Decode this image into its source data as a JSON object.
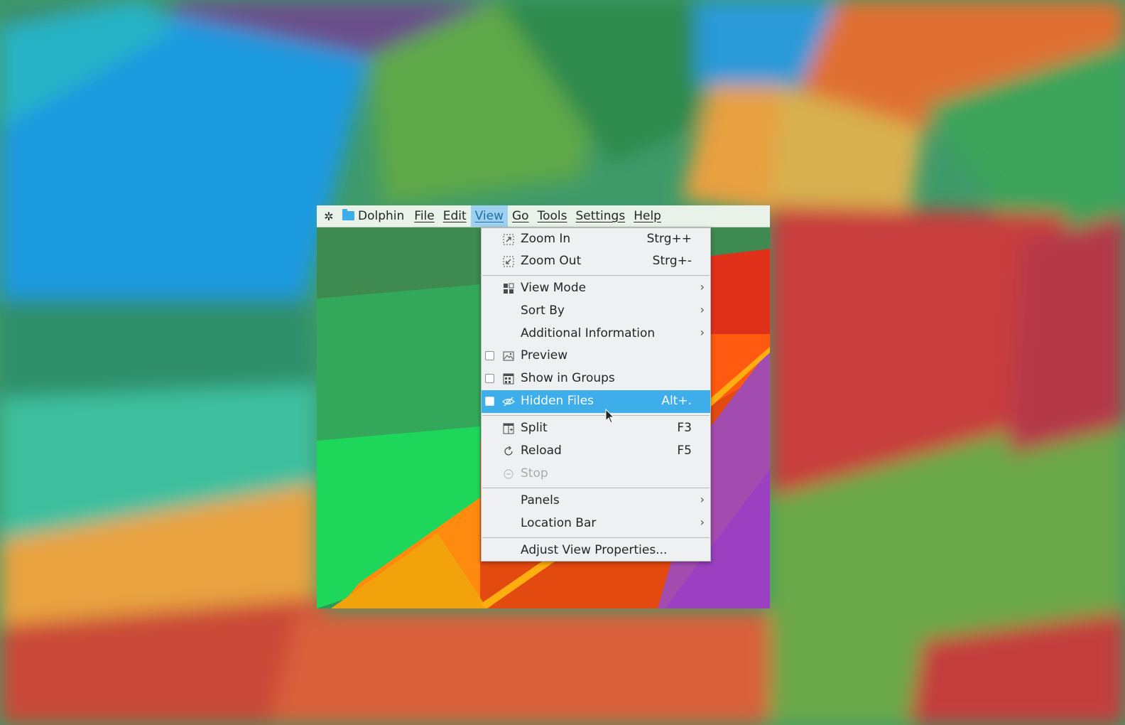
{
  "menubar": {
    "kde_logo": "kde-icon",
    "app_name": "Dolphin",
    "items": [
      "File",
      "Edit",
      "View",
      "Go",
      "Tools",
      "Settings",
      "Help"
    ],
    "active": "View"
  },
  "view_menu": {
    "zoom_in": {
      "label": "Zoom In",
      "shortcut": "Strg++",
      "icon": "zoom-in-icon"
    },
    "zoom_out": {
      "label": "Zoom Out",
      "shortcut": "Strg+-",
      "icon": "zoom-out-icon"
    },
    "view_mode": {
      "label": "View Mode",
      "icon": "view-mode-icon"
    },
    "sort_by": {
      "label": "Sort By"
    },
    "additional_info": {
      "label": "Additional Information"
    },
    "preview": {
      "label": "Preview",
      "icon": "image-icon",
      "checked": false
    },
    "show_in_groups": {
      "label": "Show in Groups",
      "icon": "groups-icon",
      "checked": false
    },
    "hidden_files": {
      "label": "Hidden Files",
      "shortcut": "Alt+.",
      "icon": "hidden-icon",
      "checked": false,
      "highlighted": true
    },
    "split": {
      "label": "Split",
      "shortcut": "F3",
      "icon": "split-icon"
    },
    "reload": {
      "label": "Reload",
      "shortcut": "F5",
      "icon": "reload-icon"
    },
    "stop": {
      "label": "Stop",
      "icon": "stop-icon",
      "disabled": true
    },
    "panels": {
      "label": "Panels"
    },
    "location_bar": {
      "label": "Location Bar"
    },
    "adjust_view": {
      "label": "Adjust View Properties..."
    }
  },
  "colors": {
    "highlight": "#3daee9",
    "menu_bg": "#eff0f1",
    "menubar_bg": "#e8f2e8",
    "text": "#232627"
  }
}
